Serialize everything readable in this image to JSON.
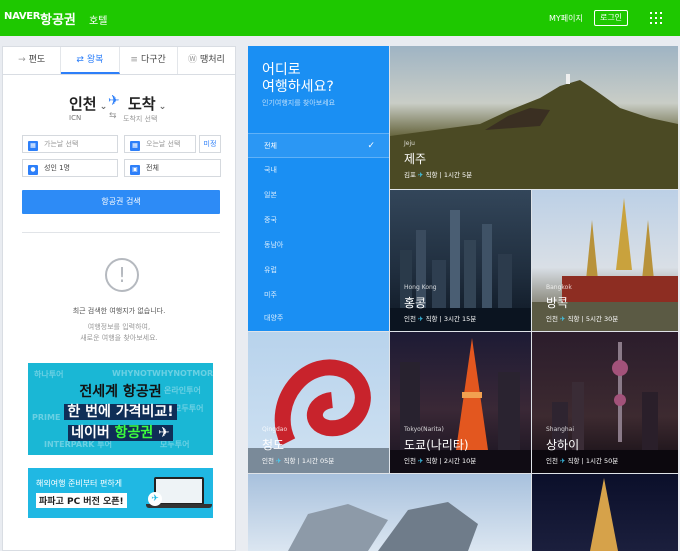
{
  "header": {
    "logo_naver": "NAVER",
    "logo_service": "항공권",
    "hotel": "호텔",
    "mypage": "MY페이지",
    "login": "로그인"
  },
  "search": {
    "tabs": [
      {
        "label": "편도",
        "icon": "arrow-right-icon"
      },
      {
        "label": "왕복",
        "icon": "round-trip-icon"
      },
      {
        "label": "다구간",
        "icon": "multi-city-icon"
      },
      {
        "label": "땡처리",
        "icon": "discount-icon"
      }
    ],
    "active_tab": "왕복",
    "from_city": "인천",
    "from_code": "ICN",
    "to_city": "도착",
    "to_hint": "도착지 선택",
    "depart_placeholder": "가는날 선택",
    "return_placeholder": "오는날 선택",
    "pending": "미정",
    "passengers": "성인 1명",
    "seat_class": "전체",
    "search_button": "항공권 검색"
  },
  "history": {
    "title": "최근 검색한 여행지가 없습니다.",
    "sub1": "여행정보를 입력하여,",
    "sub2": "새로운 여행을 찾아보세요."
  },
  "banner1": {
    "line1": "전세계 항공권",
    "line2": "한 번에 가격비교!",
    "line3_brand": "네이버",
    "line3_text": "항공권",
    "bg_words": [
      "하나투어",
      "WHYNOT",
      "WHYNOTMORE",
      "온라인투어",
      "모두투어",
      "PRIME",
      "INTERPARK 투어",
      "모두투어"
    ]
  },
  "banner2": {
    "line1": "해외여행 준비부터 편하게",
    "line2": "파파고 PC 버전 오픈!"
  },
  "destinations": {
    "title_line1": "어디로",
    "title_line2": "여행하세요?",
    "subtitle": "인기여행지를 찾아보세요",
    "menu": [
      "전체",
      "국내",
      "일본",
      "중국",
      "동남아",
      "유럽",
      "미주",
      "대양주"
    ],
    "active": "전체",
    "tiles": [
      {
        "en": "Jeju",
        "kr": "제주",
        "from": "김포",
        "type": "직항",
        "time": "1시간 5분"
      },
      {
        "en": "Hong Kong",
        "kr": "홍콩",
        "from": "인천",
        "type": "직항",
        "time": "3시간 15분"
      },
      {
        "en": "Bangkok",
        "kr": "방콕",
        "from": "인천",
        "type": "직항",
        "time": "5시간 30분"
      },
      {
        "en": "Qingdao",
        "kr": "청도",
        "from": "인천",
        "type": "직항",
        "time": "1시간 05분"
      },
      {
        "en": "Tokyo(Narita)",
        "kr": "도쿄(나리타)",
        "from": "인천",
        "type": "직항",
        "time": "2시간 10분"
      },
      {
        "en": "Shanghai",
        "kr": "상하이",
        "from": "인천",
        "type": "직항",
        "time": "1시간 50분"
      }
    ]
  },
  "colors": {
    "brand_green": "#1ec800",
    "accent_blue": "#2d8bf6",
    "nav_blue": "#1a8ff3"
  }
}
